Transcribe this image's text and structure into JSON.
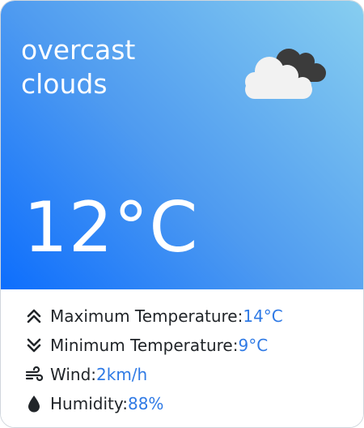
{
  "weather": {
    "description": "overcast clouds",
    "temperature": "12°C",
    "icon": "overcast-clouds-icon"
  },
  "details": {
    "max_temp": {
      "label": "Maximum Temperature: ",
      "value": "14°C",
      "icon": "chevron-double-up-icon"
    },
    "min_temp": {
      "label": "Minimum Temperature: ",
      "value": "9°C",
      "icon": "chevron-double-down-icon"
    },
    "wind": {
      "label": "Wind: ",
      "value": "2km/h",
      "icon": "wind-icon"
    },
    "humidity": {
      "label": "Humidity: ",
      "value": "88%",
      "icon": "droplet-icon"
    }
  },
  "colors": {
    "gradient_start": "#0d6efd",
    "gradient_end": "#87cef0",
    "value_accent": "#2f7ae5",
    "text": "#212529"
  }
}
